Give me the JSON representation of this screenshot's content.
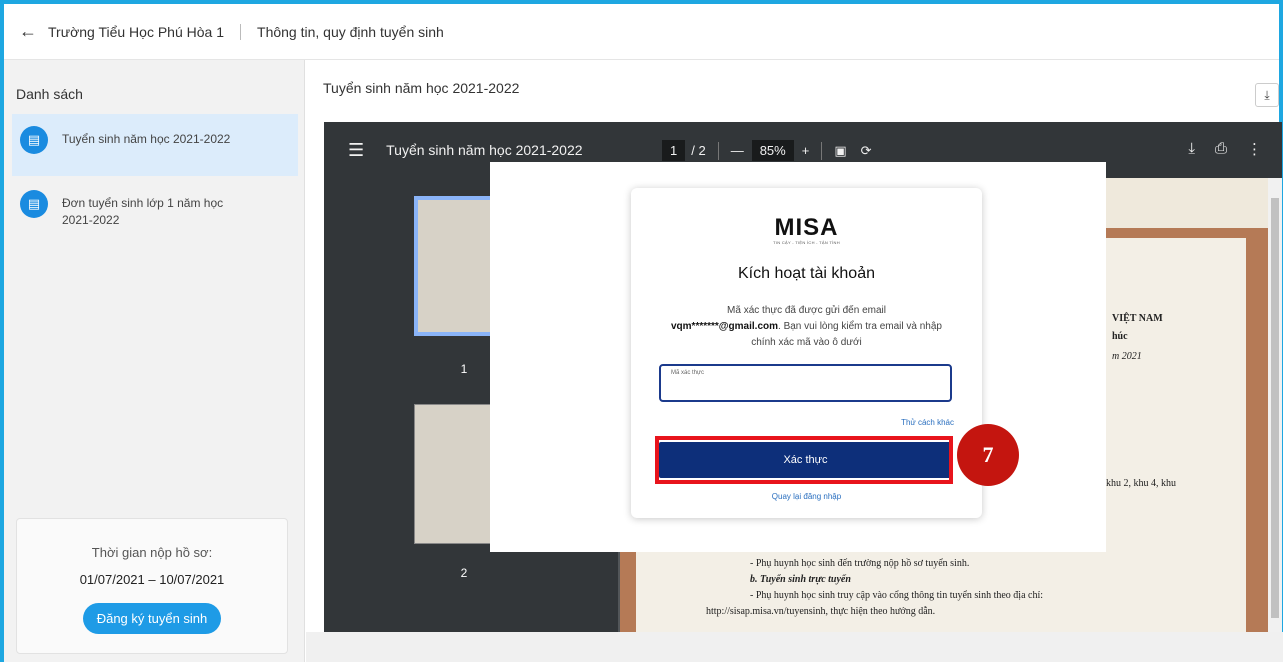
{
  "header": {
    "back_icon": "arrow-left-icon",
    "school": "Trường Tiểu Học Phú Hòa 1",
    "page": "Thông tin, quy định tuyển sinh"
  },
  "sidebar": {
    "title": "Danh sách",
    "items": [
      {
        "label": "Tuyển sinh năm học 2021-2022",
        "icon": "clipboard-icon",
        "active": true
      },
      {
        "label": "Đơn tuyển sinh lớp 1 năm học 2021-2022",
        "icon": "clipboard-icon",
        "active": false
      }
    ],
    "registration": {
      "label": "Thời gian nộp hồ sơ:",
      "dates": "01/07/2021 – 10/07/2021",
      "button": "Đăng ký tuyển sinh"
    }
  },
  "main": {
    "title": "Tuyển sinh năm học 2021-2022",
    "download_icon": "download-tray-icon"
  },
  "viewer": {
    "doc_title": "Tuyển sinh năm học 2021-2022",
    "page_current": "1",
    "page_total": "/ 2",
    "zoom": "85%",
    "zoom_out": "—",
    "zoom_in": "+",
    "thumb_labels": [
      "1",
      "2"
    ],
    "doc_lines": [
      "VIỆT NAM",
      "húc",
      "m 2021",
      "khu 2, khu 4, khu",
      "- Phụ huynh học sinh đến trường nộp hồ sơ tuyển sinh.",
      "b. Tuyển sinh trực tuyến",
      "- Phụ huynh học sinh truy cập vào cổng thông tin tuyển sinh theo địa chỉ:",
      "http://sisap.misa.vn/tuyensinh, thực hiện theo hướng dẫn."
    ]
  },
  "modal": {
    "brand": "MISA",
    "brand_tagline": "TIN CẬY - TIỆN ÍCH - TẬN TÌNH",
    "title": "Kích hoạt tài khoản",
    "message_1": "Mã xác thực đã được gửi đến email",
    "email": "vqm*******@gmail.com",
    "message_2": ". Bạn vui lòng kiểm tra email và nhập chính xác mã vào ô dưới",
    "otp_label": "Mã xác thực",
    "otp_value": "",
    "other_method": "Thử cách khác",
    "verify_button": "Xác thực",
    "back_to_login": "Quay lại đăng nhập"
  },
  "annotation": {
    "step_number": "7",
    "color": "#c4150f"
  }
}
